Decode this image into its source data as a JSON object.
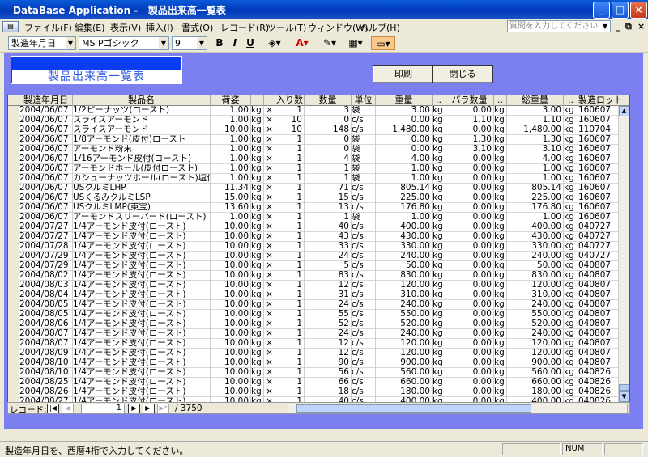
{
  "window": {
    "title": "DataBase Application -   製品出来高一覧表",
    "minimize": "_",
    "maximize": "□",
    "close": "×"
  },
  "menu": [
    "ファイル(F)",
    "編集(E)",
    "表示(V)",
    "挿入(I)",
    "書式(O)",
    "レコード(R)",
    "ツール(T)",
    "ウィンドウ(W)",
    "ヘルプ(H)"
  ],
  "ask_placeholder": "質問を入力してください",
  "toolbar": {
    "field_select": "製造年月日",
    "font_select": "MS Pゴシック",
    "size_select": "9",
    "bold": "B",
    "italic": "I",
    "underline": "U",
    "font_color": "A"
  },
  "form": {
    "title": "製品出来高一覧表",
    "print_button": "印刷",
    "close_button": "閉じる"
  },
  "columns": [
    "製造年月日",
    "製品名",
    "荷姿",
    "",
    "",
    "入り数",
    "数量",
    "単位",
    "重量",
    "..",
    "バラ数量",
    "..",
    "総重量",
    "..",
    "製造ロット"
  ],
  "rows": [
    [
      "2004/06/07",
      "1/2ピーナッツ(ロースト)",
      "1.00",
      "kg",
      "×",
      "1",
      "3",
      "袋",
      "3.00",
      "kg",
      "0.00",
      "kg",
      "3.00",
      "kg",
      "160607"
    ],
    [
      "2004/06/07",
      "スライスアーモンド",
      "1.00",
      "kg",
      "×",
      "10",
      "0",
      "c/s",
      "0.00",
      "kg",
      "1.10",
      "kg",
      "1.10",
      "kg",
      "160607"
    ],
    [
      "2004/06/07",
      "スライスアーモンド",
      "10.00",
      "kg",
      "×",
      "10",
      "148",
      "c/s",
      "1,480.00",
      "kg",
      "0.00",
      "kg",
      "1,480.00",
      "kg",
      "110704"
    ],
    [
      "2004/06/07",
      "1/8アーモンド(皮付)ロースト",
      "1.00",
      "kg",
      "×",
      "1",
      "0",
      "袋",
      "0.00",
      "kg",
      "1.30",
      "kg",
      "1.30",
      "kg",
      "160607"
    ],
    [
      "2004/06/07",
      "アーモンド粉末",
      "1.00",
      "kg",
      "×",
      "1",
      "0",
      "袋",
      "0.00",
      "kg",
      "3.10",
      "kg",
      "3.10",
      "kg",
      "160607"
    ],
    [
      "2004/06/07",
      "1/16アーモンド皮付(ロースト)",
      "1.00",
      "kg",
      "×",
      "1",
      "4",
      "袋",
      "4.00",
      "kg",
      "0.00",
      "kg",
      "4.00",
      "kg",
      "160607"
    ],
    [
      "2004/06/07",
      "アーモンドホール(皮付ロースト)",
      "1.00",
      "kg",
      "×",
      "1",
      "1",
      "袋",
      "1.00",
      "kg",
      "0.00",
      "kg",
      "1.00",
      "kg",
      "160607"
    ],
    [
      "2004/06/07",
      "カシューナッツホール(ロースト)塩付",
      "1.00",
      "kg",
      "×",
      "1",
      "1",
      "袋",
      "1.00",
      "kg",
      "0.00",
      "kg",
      "1.00",
      "kg",
      "160607"
    ],
    [
      "2004/06/07",
      "USクルミLHP",
      "11.34",
      "kg",
      "×",
      "1",
      "71",
      "c/s",
      "805.14",
      "kg",
      "0.00",
      "kg",
      "805.14",
      "kg",
      "160607"
    ],
    [
      "2004/06/07",
      "USくるみクルミLSP",
      "15.00",
      "kg",
      "×",
      "1",
      "15",
      "c/s",
      "225.00",
      "kg",
      "0.00",
      "kg",
      "225.00",
      "kg",
      "160607"
    ],
    [
      "2004/06/07",
      "USクルミLMP(東宝)",
      "13.60",
      "kg",
      "×",
      "1",
      "13",
      "c/s",
      "176.80",
      "kg",
      "0.00",
      "kg",
      "176.80",
      "kg",
      "160607"
    ],
    [
      "2004/06/07",
      "アーモンドスリーバード(ロースト)",
      "1.00",
      "kg",
      "×",
      "1",
      "1",
      "袋",
      "1.00",
      "kg",
      "0.00",
      "kg",
      "1.00",
      "kg",
      "160607"
    ],
    [
      "2004/07/27",
      "1/4アーモンド皮付(ロースト)",
      "10.00",
      "kg",
      "×",
      "1",
      "40",
      "c/s",
      "400.00",
      "kg",
      "0.00",
      "kg",
      "400.00",
      "kg",
      "040727"
    ],
    [
      "2004/07/27",
      "1/4アーモンド皮付(ロースト)",
      "10.00",
      "kg",
      "×",
      "1",
      "43",
      "c/s",
      "430.00",
      "kg",
      "0.00",
      "kg",
      "430.00",
      "kg",
      "040727"
    ],
    [
      "2004/07/28",
      "1/4アーモンド皮付(ロースト)",
      "10.00",
      "kg",
      "×",
      "1",
      "33",
      "c/s",
      "330.00",
      "kg",
      "0.00",
      "kg",
      "330.00",
      "kg",
      "040727"
    ],
    [
      "2004/07/29",
      "1/4アーモンド皮付(ロースト)",
      "10.00",
      "kg",
      "×",
      "1",
      "24",
      "c/s",
      "240.00",
      "kg",
      "0.00",
      "kg",
      "240.00",
      "kg",
      "040727"
    ],
    [
      "2004/07/29",
      "1/4アーモンド皮付(ロースト)",
      "10.00",
      "kg",
      "×",
      "1",
      "5",
      "c/s",
      "50.00",
      "kg",
      "0.00",
      "kg",
      "50.00",
      "kg",
      "040807"
    ],
    [
      "2004/08/02",
      "1/4アーモンド皮付(ロースト)",
      "10.00",
      "kg",
      "×",
      "1",
      "83",
      "c/s",
      "830.00",
      "kg",
      "0.00",
      "kg",
      "830.00",
      "kg",
      "040807"
    ],
    [
      "2004/08/03",
      "1/4アーモンド皮付(ロースト)",
      "10.00",
      "kg",
      "×",
      "1",
      "12",
      "c/s",
      "120.00",
      "kg",
      "0.00",
      "kg",
      "120.00",
      "kg",
      "040807"
    ],
    [
      "2004/08/04",
      "1/4アーモンド皮付(ロースト)",
      "10.00",
      "kg",
      "×",
      "1",
      "31",
      "c/s",
      "310.00",
      "kg",
      "0.00",
      "kg",
      "310.00",
      "kg",
      "040807"
    ],
    [
      "2004/08/05",
      "1/4アーモンド皮付(ロースト)",
      "10.00",
      "kg",
      "×",
      "1",
      "24",
      "c/s",
      "240.00",
      "kg",
      "0.00",
      "kg",
      "240.00",
      "kg",
      "040807"
    ],
    [
      "2004/08/05",
      "1/4アーモンド皮付(ロースト)",
      "10.00",
      "kg",
      "×",
      "1",
      "55",
      "c/s",
      "550.00",
      "kg",
      "0.00",
      "kg",
      "550.00",
      "kg",
      "040807"
    ],
    [
      "2004/08/06",
      "1/4アーモンド皮付(ロースト)",
      "10.00",
      "kg",
      "×",
      "1",
      "52",
      "c/s",
      "520.00",
      "kg",
      "0.00",
      "kg",
      "520.00",
      "kg",
      "040807"
    ],
    [
      "2004/08/07",
      "1/4アーモンド皮付(ロースト)",
      "10.00",
      "kg",
      "×",
      "1",
      "24",
      "c/s",
      "240.00",
      "kg",
      "0.00",
      "kg",
      "240.00",
      "kg",
      "040807"
    ],
    [
      "2004/08/07",
      "1/4アーモンド皮付(ロースト)",
      "10.00",
      "kg",
      "×",
      "1",
      "12",
      "c/s",
      "120.00",
      "kg",
      "0.00",
      "kg",
      "120.00",
      "kg",
      "040807"
    ],
    [
      "2004/08/09",
      "1/4アーモンド皮付(ロースト)",
      "10.00",
      "kg",
      "×",
      "1",
      "12",
      "c/s",
      "120.00",
      "kg",
      "0.00",
      "kg",
      "120.00",
      "kg",
      "040807"
    ],
    [
      "2004/08/10",
      "1/4アーモンド皮付(ロースト)",
      "10.00",
      "kg",
      "×",
      "1",
      "90",
      "c/s",
      "900.00",
      "kg",
      "0.00",
      "kg",
      "900.00",
      "kg",
      "040807"
    ],
    [
      "2004/08/10",
      "1/4アーモンド皮付(ロースト)",
      "10.00",
      "kg",
      "×",
      "1",
      "56",
      "c/s",
      "560.00",
      "kg",
      "0.00",
      "kg",
      "560.00",
      "kg",
      "040826"
    ],
    [
      "2004/08/25",
      "1/4アーモンド皮付(ロースト)",
      "10.00",
      "kg",
      "×",
      "1",
      "66",
      "c/s",
      "660.00",
      "kg",
      "0.00",
      "kg",
      "660.00",
      "kg",
      "040826"
    ],
    [
      "2004/08/26",
      "1/4アーモンド皮付(ロースト)",
      "10.00",
      "kg",
      "×",
      "1",
      "18",
      "c/s",
      "180.00",
      "kg",
      "0.00",
      "kg",
      "180.00",
      "kg",
      "040826"
    ],
    [
      "2004/08/27",
      "1/4アーモンド皮付(ロースト)",
      "10.00",
      "kg",
      "×",
      "1",
      "40",
      "c/s",
      "400.00",
      "kg",
      "0.00",
      "kg",
      "400.00",
      "kg",
      "040826"
    ]
  ],
  "nav": {
    "label": "レコード:",
    "current": "1",
    "total": "/  3750"
  },
  "status": {
    "message": "製造年月日を、西暦4桁で入力してください。",
    "num": "NUM"
  }
}
